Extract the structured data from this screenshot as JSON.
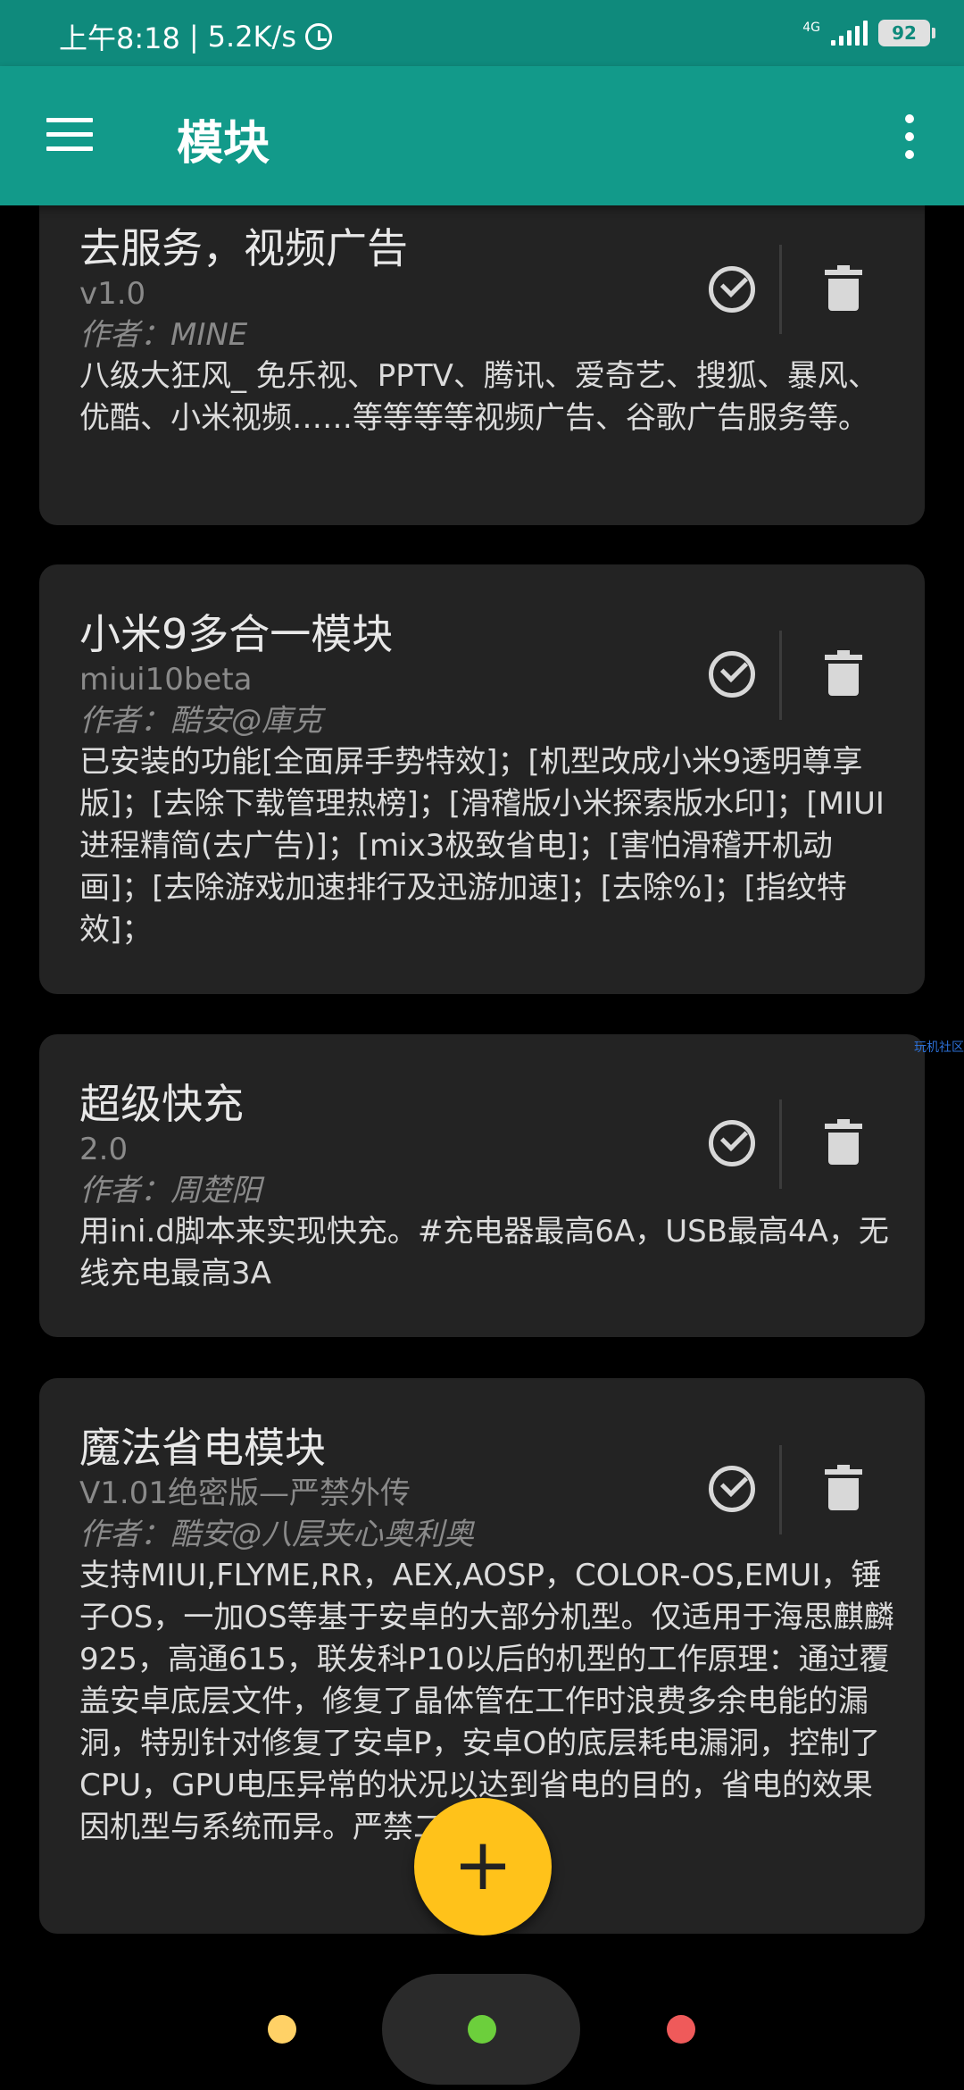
{
  "status_bar": {
    "time": "上午8:18",
    "separator": "|",
    "speed": "5.2K/s",
    "network": "4G",
    "battery": "92"
  },
  "app_bar": {
    "title": "模块"
  },
  "modules": [
    {
      "title": "去服务，视频广告",
      "version": "v1.0",
      "author": "作者：MINE",
      "description": "八级大狂风_ 免乐视、PPTV、腾讯、爱奇艺、搜狐、暴风、优酷、小米视频……等等等等视频广告、谷歌广告服务等。"
    },
    {
      "title": "小米9多合一模块",
      "version": "miui10beta",
      "author": "作者：酷安@庫克",
      "description": "已安装的功能[全面屏手势特效]；[机型改成小米9透明尊享版]；[去除下载管理热榜]；[滑稽版小米探索版水印]；[MIUI进程精简(去广告)]；[mix3极致省电]；[害怕滑稽开机动画]；[去除游戏加速排行及迅游加速]；[去除%]；[指纹特效]；"
    },
    {
      "title": "超级快充",
      "version": "2.0",
      "author": "作者：周楚阳",
      "description": "用ini.d脚本来实现快充。#充电器最高6A，USB最高4A，无线充电最高3A"
    },
    {
      "title": "魔法省电模块",
      "version": "V1.01绝密版—严禁外传",
      "author": "作者：酷安@八层夹心奥利奥",
      "description": "支持MIUI,FLYME,RR，AEX,AOSP，COLOR-OS,EMUI，锤子OS，一加OS等基于安卓的大部分机型。仅适用于海思麒麟925，高通615，联发科P10以后的机型的工作原理：通过覆盖安卓底层文件，修复了晶体管在工作时浪费多余电能的漏洞，特别针对修复了安卓P，安卓O的底层耗电漏洞，控制了CPU，GPU电压异常的状况以达到省电的目的，省电的效果因机型与系统而异。严禁二传"
    }
  ],
  "watermark": "玩机社区",
  "fab": {
    "label": "+"
  },
  "colors": {
    "status_bar": "#0f8a7c",
    "app_bar": "#129a8a",
    "card": "#232323",
    "fab": "#ffc21a",
    "dot_yellow": "#ffd166",
    "dot_green": "#6ccf3c",
    "dot_red": "#ef5a5a"
  },
  "icons": {
    "menu": "hamburger-menu-icon",
    "overflow": "more-vert-icon",
    "check": "check-circle-icon",
    "delete": "trash-icon",
    "alarm": "alarm-clock-icon",
    "signal": "signal-bars-icon",
    "battery": "battery-icon"
  }
}
